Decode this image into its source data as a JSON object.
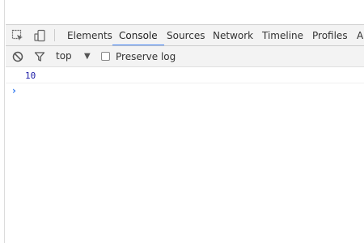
{
  "toolbar": {
    "inspect_icon": "inspect-element-icon",
    "device_icon": "device-mode-icon"
  },
  "tabs": [
    {
      "label": "Elements"
    },
    {
      "label": "Console",
      "active": true
    },
    {
      "label": "Sources"
    },
    {
      "label": "Network"
    },
    {
      "label": "Timeline"
    },
    {
      "label": "Profiles"
    },
    {
      "label": "A"
    }
  ],
  "filterbar": {
    "clear_icon": "clear-console-icon",
    "filter_icon": "filter-icon",
    "context": "top",
    "context_arrow": "▼",
    "preserve_log_label": "Preserve log",
    "preserve_log_checked": false
  },
  "console": {
    "output_value": "10",
    "prompt_symbol": "›"
  },
  "colors": {
    "accent": "#3e82f7",
    "number": "#1a1aa6",
    "prompt": "#367cf1"
  }
}
